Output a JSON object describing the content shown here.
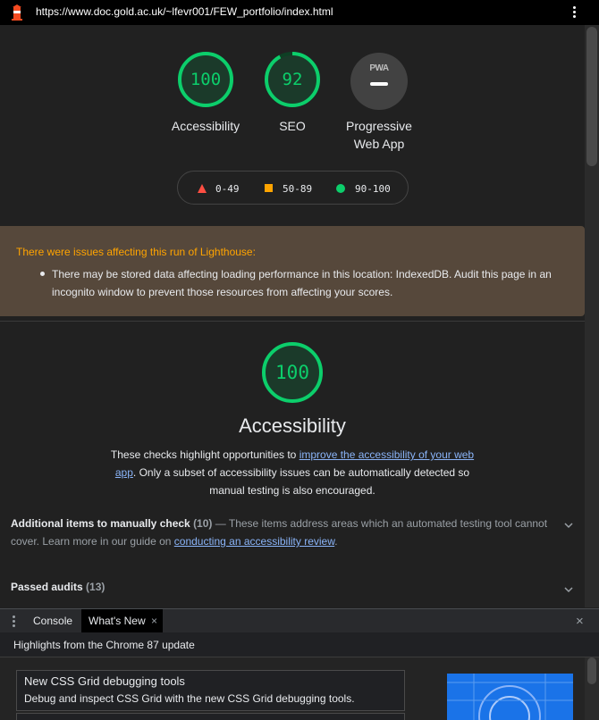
{
  "browser": {
    "url": "https://www.doc.gold.ac.uk/~lfevr001/FEW_portfolio/index.html"
  },
  "scores": [
    {
      "label": "Accessibility",
      "value": "100",
      "score": 100
    },
    {
      "label": "SEO",
      "value": "92",
      "score": 92
    }
  ],
  "pwa": {
    "badge": "PWA",
    "label_line1": "Progressive",
    "label_line2": "Web App"
  },
  "legend": {
    "fail": "0-49",
    "average": "50-89",
    "pass": "90-100"
  },
  "warning": {
    "title": "There were issues affecting this run of Lighthouse:",
    "item": "There may be stored data affecting loading performance in this location: IndexedDB. Audit this page in an incognito window to prevent those resources from affecting your scores."
  },
  "category": {
    "score": "100",
    "score_value": 100,
    "title": "Accessibility",
    "desc_prefix": "These checks highlight opportunities to ",
    "desc_link": "improve the accessibility of your web app",
    "desc_suffix": ". Only a subset of accessibility issues can be automatically detected so manual testing is also encouraged."
  },
  "manual": {
    "title": "Additional items to manually check",
    "count": "(10)",
    "desc": " — These items address areas which an automated testing tool cannot cover. Learn more in our guide on ",
    "link": "conducting an accessibility review",
    "end": "."
  },
  "passed": {
    "title": "Passed audits",
    "count": "(13)"
  },
  "drawer": {
    "tabs": [
      "Console",
      "What's New"
    ],
    "close_glyph": "×",
    "highlights": "Highlights from the Chrome 87 update",
    "card_title": "New CSS Grid debugging tools",
    "card_desc": "Debug and inspect CSS Grid with the new CSS Grid debugging tools."
  },
  "colors": {
    "pass": "#0cce6b",
    "average": "#ffa400",
    "fail": "#ff4e42",
    "link": "#8ab4f8"
  }
}
